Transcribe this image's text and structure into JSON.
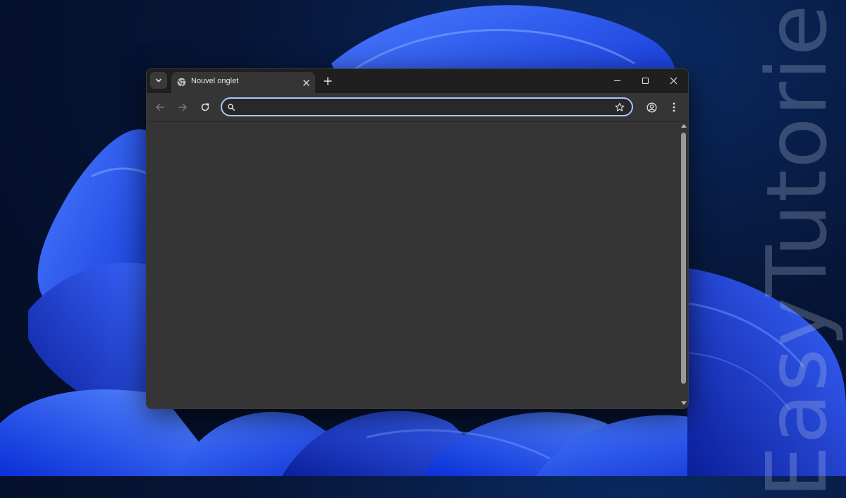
{
  "watermark": {
    "text": "EasyTutoriel"
  },
  "tab": {
    "title": "Nouvel onglet",
    "favicon": "chrome-icon"
  },
  "tab_search": {
    "icon": "chevron-down-icon"
  },
  "new_tab": {
    "icon": "plus-icon"
  },
  "window_controls": {
    "minimize_icon": "minimize-icon",
    "maximize_icon": "maximize-icon",
    "close_icon": "close-icon"
  },
  "toolbar": {
    "back_icon": "arrow-left-icon",
    "forward_icon": "arrow-right-icon",
    "reload_icon": "reload-icon",
    "profile_icon": "profile-icon",
    "menu_icon": "kebab-menu-icon"
  },
  "omnibox": {
    "value": "",
    "search_icon": "search-icon",
    "bookmark_icon": "star-icon",
    "border_color": "#a8c7fa"
  },
  "colors": {
    "titlebar": "#1f1f1f",
    "tab_active": "#353535",
    "toolbar": "#353535",
    "content": "#353535",
    "wallpaper_blue": "#1e4cff"
  }
}
